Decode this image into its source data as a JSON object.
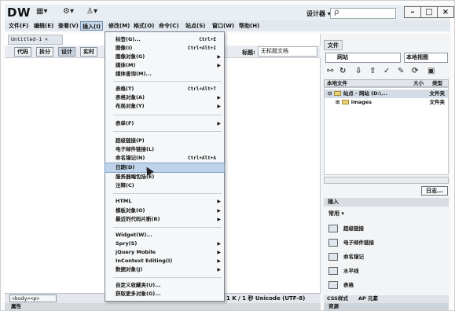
{
  "app": {
    "logo": "DW",
    "workspace": "设计器",
    "search_value": "ρ",
    "toolbar_icons": [
      "layout-icon",
      "extend-icon",
      "site-icon"
    ]
  },
  "window_controls": [
    "–",
    "□",
    "×"
  ],
  "menubar": [
    {
      "label": "文件(F)"
    },
    {
      "label": "编辑(E)"
    },
    {
      "label": "查看(V)"
    },
    {
      "label": "插入(I)",
      "active": true
    },
    {
      "label": "修改(M)"
    },
    {
      "label": "格式(O)"
    },
    {
      "label": "命令(C)"
    },
    {
      "label": "站点(S)"
    },
    {
      "label": "窗口(W)"
    },
    {
      "label": "帮助(H)"
    }
  ],
  "document": {
    "tab_label": "Untitled-1 ×",
    "view_buttons": [
      "代码",
      "拆分",
      "设计",
      "实时"
    ],
    "active_view": "设计",
    "title_label": "标题:",
    "title_value": "无标题文档"
  },
  "insert_menu": {
    "groups": [
      [
        {
          "label": "标签(G)...",
          "shortcut": "Ctrl+E"
        },
        {
          "label": "图像(I)",
          "shortcut": "Ctrl+Alt+I"
        },
        {
          "label": "图像对象(G)",
          "submenu": true
        },
        {
          "label": "媒体(M)",
          "submenu": true
        },
        {
          "label": "媒体查询(M)..."
        }
      ],
      [
        {
          "label": "表格(T)",
          "shortcut": "Ctrl+Alt+T"
        },
        {
          "label": "表格对象(A)",
          "submenu": true
        },
        {
          "label": "布局对象(Y)",
          "submenu": true
        }
      ],
      [
        {
          "label": "表单(F)",
          "submenu": true
        }
      ],
      [
        {
          "label": "超级链接(P)"
        },
        {
          "label": "电子邮件链接(L)"
        },
        {
          "label": "命名锚记(N)",
          "shortcut": "Ctrl+Alt+A"
        },
        {
          "label": "日期(D)",
          "highlighted": true
        },
        {
          "label": "服务器端包括(E)"
        },
        {
          "label": "注释(C)"
        }
      ],
      [
        {
          "label": "HTML",
          "submenu": true
        },
        {
          "label": "模板对象(O)",
          "submenu": true
        },
        {
          "label": "最近的代码片断(R)",
          "submenu": true
        }
      ],
      [
        {
          "label": "Widget(W)..."
        },
        {
          "label": "Spry(S)",
          "submenu": true
        },
        {
          "label": "jQuery Mobile",
          "submenu": true
        },
        {
          "label": "InContext Editing(I)",
          "submenu": true
        },
        {
          "label": "数据对象(J)",
          "submenu": true
        }
      ],
      [
        {
          "label": "自定义收藏夹(U)..."
        },
        {
          "label": "获取更多对象(G)..."
        }
      ]
    ]
  },
  "status": {
    "tag_path": "<body><p>",
    "info": "1 K / 1 秒 Unicode (UTF-8)"
  },
  "properties_bar": "属性",
  "files_panel": {
    "tab_label": "文件",
    "site_select": "网站",
    "view_select": "本地视图",
    "columns": [
      "本地文件",
      "大小",
      "类型"
    ],
    "rows": [
      {
        "name": "站点 - 网站 (D:\\...",
        "type": "文件夹",
        "selected": true
      },
      {
        "name": "images",
        "type": "文件夹"
      }
    ],
    "log_button": "日志..."
  },
  "insert_panel": {
    "tab_label": "插入",
    "category": "常用",
    "items": [
      {
        "label": "超级链接",
        "icon": "hyperlink-icon"
      },
      {
        "label": "电子邮件链接",
        "icon": "email-icon"
      },
      {
        "label": "命名锚记",
        "icon": "anchor-icon"
      },
      {
        "label": "水平线",
        "icon": "hr-icon"
      },
      {
        "label": "表格",
        "icon": "table-icon"
      }
    ]
  },
  "bottom_tabs": [
    "CSS样式",
    "AP 元素"
  ],
  "right_bottom_label": "资源"
}
